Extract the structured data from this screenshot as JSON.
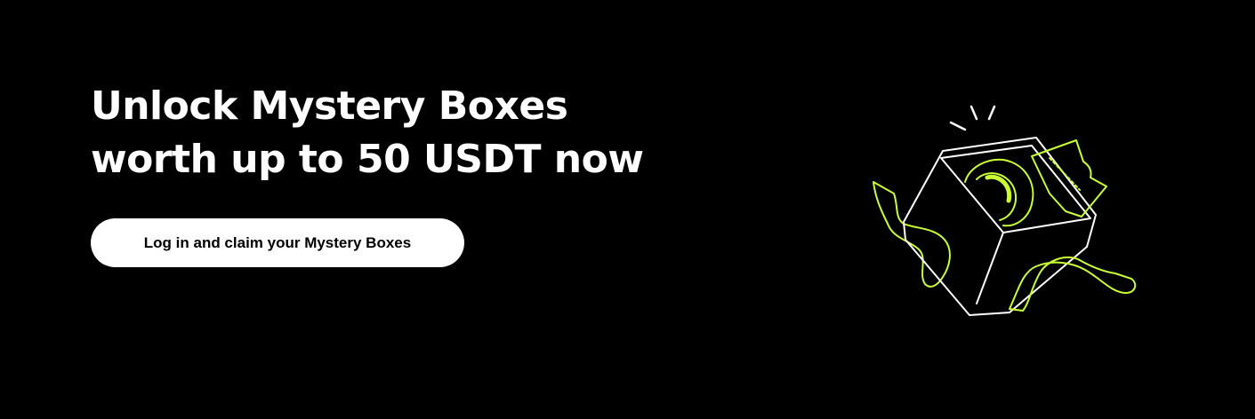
{
  "hero": {
    "headline_line1": "Unlock Mystery Boxes",
    "headline_line2": "worth up to 50 USDT now",
    "cta_label": "Log in and claim your Mystery Boxes",
    "illustration_icon": "mystery-box-icon"
  },
  "colors": {
    "background": "#000000",
    "text": "#ffffff",
    "button_bg": "#ffffff",
    "button_text": "#000000",
    "accent": "#c8ff32"
  }
}
